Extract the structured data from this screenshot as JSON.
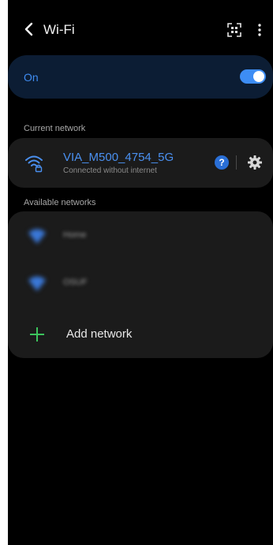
{
  "header": {
    "title": "Wi-Fi",
    "back_icon": "chevron-left-icon",
    "scan_icon": "qr-scan-icon",
    "more_icon": "more-vertical-icon"
  },
  "master_switch": {
    "label": "On",
    "enabled": true
  },
  "current_network": {
    "section_label": "Current network",
    "name": "VIA_M500_4754_5G",
    "status": "Connected without internet",
    "icon": "wifi-lock-icon",
    "help_glyph": "?",
    "settings_icon": "gear-icon"
  },
  "available_networks": {
    "section_label": "Available networks",
    "items": [
      {
        "name": "Home",
        "icon": "wifi-icon"
      },
      {
        "name": "OSUF",
        "icon": "wifi-icon"
      }
    ],
    "add_label": "Add network",
    "add_icon": "plus-icon"
  },
  "colors": {
    "background": "#000000",
    "card": "#1b1b1b",
    "master_row": "#0c1d34",
    "accent": "#3d8df5",
    "add_plus": "#3cc35c"
  }
}
